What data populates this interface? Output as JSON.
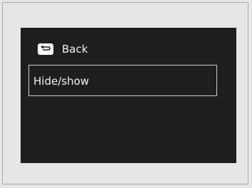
{
  "menu": {
    "back_label": "Back",
    "items": [
      {
        "label": "Hide/show"
      }
    ]
  },
  "icons": {
    "back": "return-arrow-icon"
  },
  "colors": {
    "screen_background": "#1f1d1d",
    "page_background": "#e6e6e6",
    "text": "#f2f2f2",
    "selection_border": "#cfcfcf"
  }
}
